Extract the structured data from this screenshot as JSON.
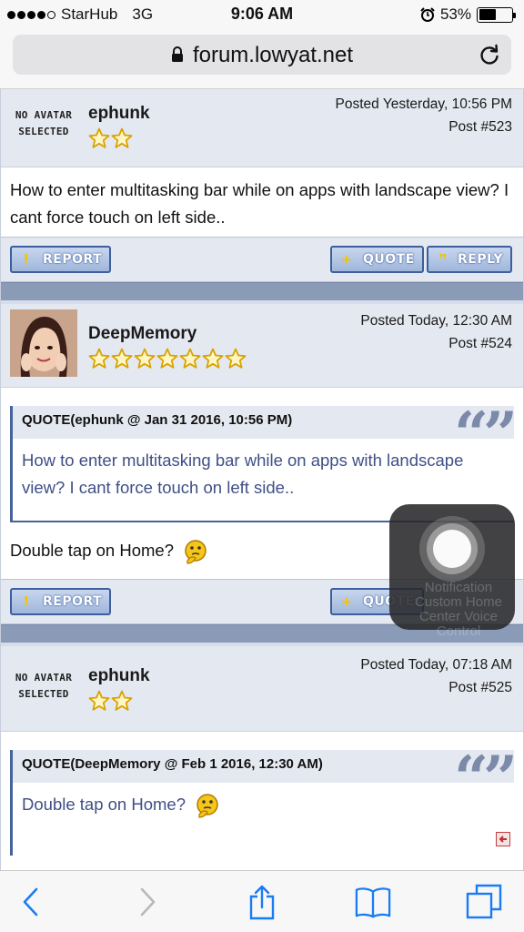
{
  "status_bar": {
    "carrier": "StarHub",
    "network": "3G",
    "time": "9:06 AM",
    "battery_percent": "53%",
    "battery_level": 0.53
  },
  "address_bar": {
    "url": "forum.lowyat.net",
    "icons": [
      "lock-icon",
      "reload-icon"
    ]
  },
  "posts": [
    {
      "avatar_text": "NO AVATAR SELECTED",
      "username": "ephunk",
      "stars": 2,
      "posted": "Posted Yesterday, 10:56 PM",
      "post_no": "Post #523",
      "body": "How to enter multitasking bar while on apps with landscape view? I cant force touch on left side..",
      "buttons": {
        "report": "REPORT",
        "quote": "QUOTE",
        "reply": "REPLY"
      }
    },
    {
      "username": "DeepMemory",
      "stars": 7,
      "posted": "Posted Today, 12:30 AM",
      "post_no": "Post #524",
      "quote_header": "QUOTE(ephunk @ Jan 31 2016, 10:56 PM)",
      "quote_text": "How to enter multitasking bar while on apps with landscape view? I cant force touch on left side..",
      "body": "Double tap on Home?",
      "buttons": {
        "report": "REPORT",
        "quote": "QUOTE"
      }
    },
    {
      "avatar_text": "NO AVATAR SELECTED",
      "username": "ephunk",
      "stars": 2,
      "posted": "Posted Today, 07:18 AM",
      "post_no": "Post #525",
      "quote_header": "QUOTE(DeepMemory @ Feb 1 2016, 12:30 AM)",
      "quote_text": "Double tap on Home?"
    }
  ],
  "assistive_touch": {
    "ghost_text": "Notification Custom Home Center Voice Control"
  },
  "toolbar": {
    "icons": [
      "back-icon",
      "forward-icon",
      "share-icon",
      "bookmarks-icon",
      "tabs-icon"
    ]
  },
  "colors": {
    "header_bg": "#e4e8f0",
    "quote_text": "#3f4f86",
    "button_border": "#3d5f9b",
    "safari_blue": "#1a7cf5"
  }
}
